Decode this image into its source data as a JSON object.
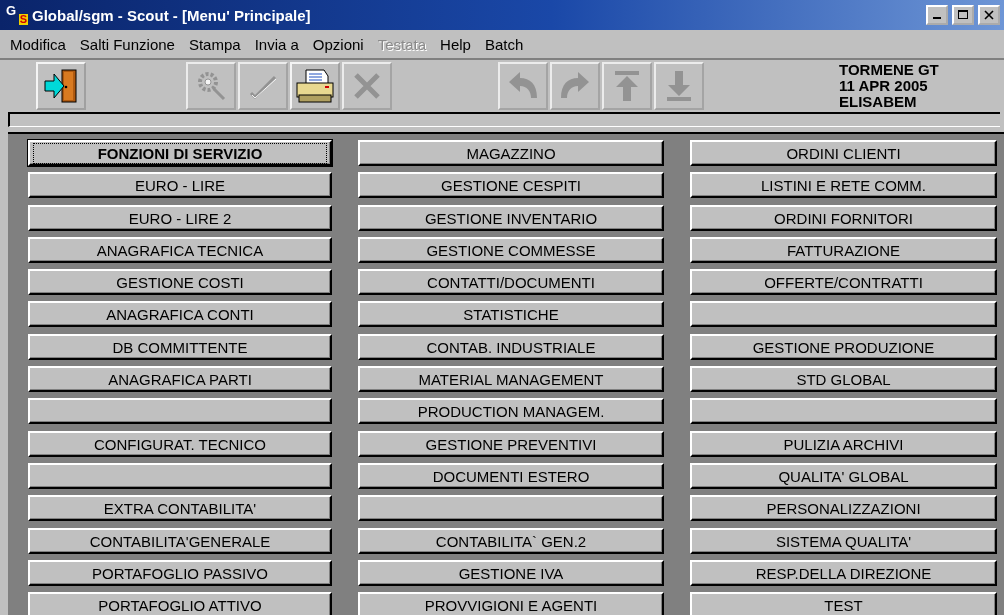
{
  "window": {
    "logo": [
      "G",
      "S"
    ],
    "title": "Global/sgm - Scout - [Menu' Principale]"
  },
  "menu_bar": [
    {
      "label": "Modifica",
      "disabled": false
    },
    {
      "label": "Salti Funzione",
      "disabled": false
    },
    {
      "label": "Stampa",
      "disabled": false
    },
    {
      "label": "Invia a",
      "disabled": false
    },
    {
      "label": "Opzioni",
      "disabled": false
    },
    {
      "label": "Testata",
      "disabled": true
    },
    {
      "label": "Help",
      "disabled": false
    },
    {
      "label": "Batch",
      "disabled": false
    }
  ],
  "toolbar": {
    "groups": [
      [
        {
          "kind": "exit",
          "disabled": false
        }
      ],
      [
        {
          "kind": "gear",
          "disabled": true
        },
        {
          "kind": "check",
          "disabled": true
        },
        {
          "kind": "print",
          "disabled": false
        },
        {
          "kind": "delete",
          "disabled": true
        }
      ],
      [
        {
          "kind": "undo",
          "disabled": true
        },
        {
          "kind": "redo",
          "disabled": true
        },
        {
          "kind": "top",
          "disabled": true
        },
        {
          "kind": "bottom",
          "disabled": true
        }
      ]
    ],
    "info": [
      "TORMENE GT",
      "11 APR 2005",
      "ELISABEM"
    ]
  },
  "menu_grid": {
    "columns": [
      {
        "buttons": [
          {
            "label": "FONZIONI DI SERVIZIO",
            "focused": true
          },
          {
            "label": "EURO - LIRE",
            "focused": false
          },
          {
            "label": "EURO - LIRE 2",
            "focused": false
          },
          {
            "label": "ANAGRAFICA TECNICA",
            "focused": false
          },
          {
            "label": "GESTIONE COSTI",
            "focused": false
          },
          {
            "label": "ANAGRAFICA  CONTI",
            "focused": false
          },
          {
            "label": "DB COMMITTENTE",
            "focused": false
          },
          {
            "label": "ANAGRAFICA  PARTI",
            "focused": false
          },
          {
            "focused": false
          },
          {
            "label": "CONFIGURAT. TECNICO",
            "focused": false
          },
          {
            "focused": false
          },
          {
            "label": "EXTRA CONTABILITA'",
            "focused": false
          },
          {
            "label": "CONTABILITA'GENERALE",
            "focused": false
          },
          {
            "label": "PORTAFOGLIO PASSIVO",
            "focused": false
          },
          {
            "label": "PORTAFOGLIO ATTIVO",
            "focused": false
          }
        ]
      },
      {
        "buttons": [
          {
            "label": "MAGAZZINO",
            "focused": false
          },
          {
            "label": "GESTIONE CESPITI",
            "focused": false
          },
          {
            "label": "GESTIONE INVENTARIO",
            "focused": false
          },
          {
            "label": "GESTIONE COMMESSE",
            "focused": false
          },
          {
            "label": "CONTATTI/DOCUMENTI",
            "focused": false
          },
          {
            "label": "STATISTICHE",
            "focused": false
          },
          {
            "label": "CONTAB. INDUSTRIALE",
            "focused": false
          },
          {
            "label": "MATERIAL MANAGEMENT",
            "focused": false
          },
          {
            "label": "PRODUCTION MANAGEM.",
            "focused": false
          },
          {
            "label": "GESTIONE PREVENTIVI",
            "focused": false
          },
          {
            "label": "DOCUMENTI ESTERO",
            "focused": false
          },
          {
            "focused": false
          },
          {
            "label": "CONTABILITA` GEN.2",
            "focused": false
          },
          {
            "label": "GESTIONE IVA",
            "focused": false
          },
          {
            "label": "PROVVIGIONI E AGENTI",
            "focused": false
          }
        ]
      },
      {
        "buttons": [
          {
            "label": "ORDINI CLIENTI",
            "focused": false
          },
          {
            "label": "LISTINI E RETE COMM.",
            "focused": false
          },
          {
            "label": "ORDINI FORNITORI",
            "focused": false
          },
          {
            "label": "FATTURAZIONE",
            "focused": false
          },
          {
            "label": "OFFERTE/CONTRATTI",
            "focused": false
          },
          {
            "focused": false
          },
          {
            "label": "GESTIONE PRODUZIONE",
            "focused": false
          },
          {
            "label": "STD GLOBAL",
            "focused": false
          },
          {
            "focused": false
          },
          {
            "label": "PULIZIA ARCHIVI",
            "focused": false
          },
          {
            "label": "QUALITA' GLOBAL",
            "focused": false
          },
          {
            "label": "PERSONALIZZAZIONI",
            "focused": false
          },
          {
            "label": "SISTEMA QUALITA'",
            "focused": false
          },
          {
            "label": "RESP.DELLA DIREZIONE",
            "focused": false
          },
          {
            "label": "TEST",
            "focused": false
          }
        ]
      }
    ]
  }
}
